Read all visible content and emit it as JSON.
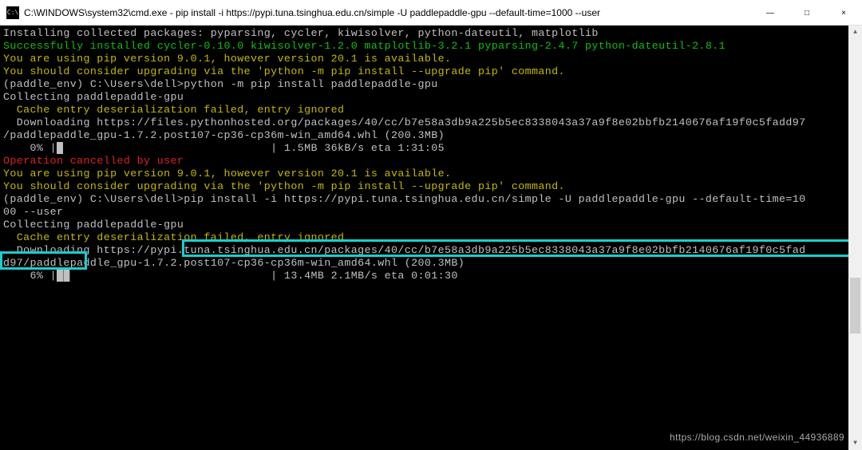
{
  "titlebar": {
    "icon_label": "C:\\",
    "title": "C:\\WINDOWS\\system32\\cmd.exe - pip  install -i https://pypi.tuna.tsinghua.edu.cn/simple -U paddlepaddle-gpu --default-time=1000 --user",
    "minimize": "—",
    "maximize": "□",
    "close": "×"
  },
  "lines": {
    "l1": "Installing collected packages: pyparsing, cycler, kiwisolver, python-dateutil, matplotlib",
    "l2": "Successfully installed cycler-0.10.0 kiwisolver-1.2.0 matplotlib-3.2.1 pyparsing-2.4.7 python-dateutil-2.8.1",
    "l3": "You are using pip version 9.0.1, however version 20.1 is available.",
    "l4": "You should consider upgrading via the 'python -m pip install --upgrade pip' command.",
    "l5": "",
    "l6": "(paddle_env) C:\\Users\\dell>python -m pip install paddlepaddle-gpu",
    "l7": "Collecting paddlepaddle-gpu",
    "l8": "  Cache entry deserialization failed, entry ignored",
    "l9a": "  Downloading https://files.pythonhosted.org/packages/40/cc/b7e58a3db9a225b5ec8338043a37a9f8e02bbfb2140676af19f0c5fadd97",
    "l9b": "/paddlepaddle_gpu-1.7.2.post107-cp36-cp36m-win_amd64.whl (200.3MB)",
    "l10": "    0% |█                               | 1.5MB 36kB/s eta 1:31:05",
    "l11": "Operation cancelled by user",
    "l12": "You are using pip version 9.0.1, however version 20.1 is available.",
    "l13": "You should consider upgrading via the 'python -m pip install --upgrade pip' command.",
    "l14": "",
    "l15a": "(paddle_env) C:\\Users\\dell>pip install -i https://pypi.tuna.tsinghua.edu.cn/simple -U paddlepaddle-gpu --default-time=10",
    "l15b": "00 --user",
    "l16": "Collecting paddlepaddle-gpu",
    "l17": "  Cache entry deserialization failed, entry ignored",
    "l18a": "  Downloading https://pypi.tuna.tsinghua.edu.cn/packages/40/cc/b7e58a3db9a225b5ec8338043a37a9f8e02bbfb2140676af19f0c5fad",
    "l18b": "d97/paddlepaddle_gpu-1.7.2.post107-cp36-cp36m-win_amd64.whl (200.3MB)",
    "l19": "    6% |██                              | 13.4MB 2.1MB/s eta 0:01:30"
  },
  "watermark": "https://blog.csdn.net/weixin_44936889"
}
